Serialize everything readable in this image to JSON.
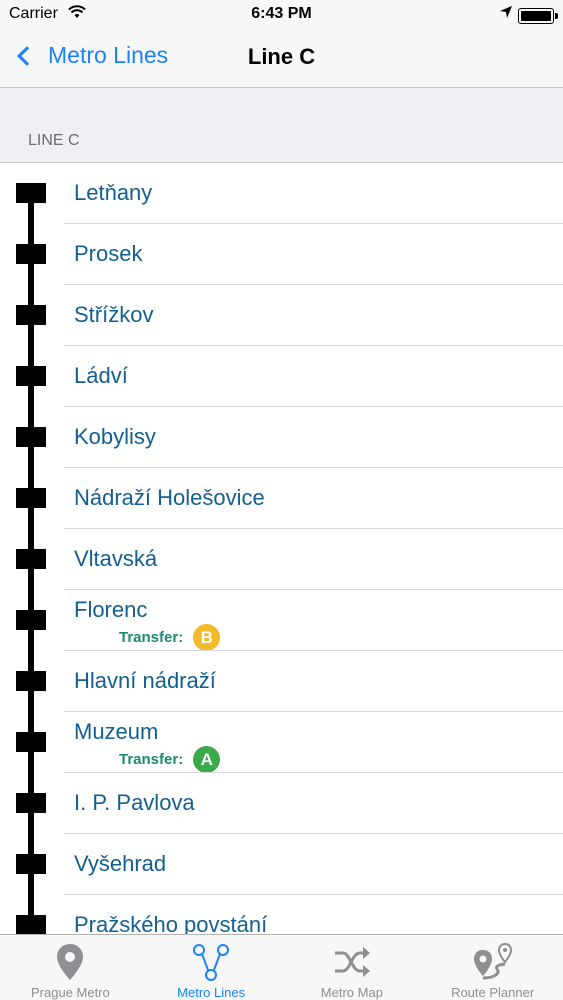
{
  "status_bar": {
    "carrier": "Carrier",
    "time": "6:43 PM"
  },
  "nav": {
    "back_label": "Metro Lines",
    "title": "Line C"
  },
  "section_header": "LINE C",
  "stations": [
    {
      "name": "Letňany"
    },
    {
      "name": "Prosek"
    },
    {
      "name": "Střížkov"
    },
    {
      "name": "Ládví"
    },
    {
      "name": "Kobylisy"
    },
    {
      "name": "Nádraží Holešovice"
    },
    {
      "name": "Vltavská"
    },
    {
      "name": "Florenc",
      "transfer_label": "Transfer:",
      "transfer_line": "B",
      "transfer_color": "#f2b928"
    },
    {
      "name": "Hlavní nádraží"
    },
    {
      "name": "Muzeum",
      "transfer_label": "Transfer:",
      "transfer_line": "A",
      "transfer_color": "#3aaa4a"
    },
    {
      "name": "I. P. Pavlova"
    },
    {
      "name": "Vyšehrad"
    },
    {
      "name": "Pražského povstání"
    }
  ],
  "tabs": [
    {
      "label": "Prague Metro",
      "icon": "map-pin-icon",
      "active": false
    },
    {
      "label": "Metro Lines",
      "icon": "metro-lines-icon",
      "active": true
    },
    {
      "label": "Metro Map",
      "icon": "shuffle-icon",
      "active": false
    },
    {
      "label": "Route Planner",
      "icon": "route-planner-icon",
      "active": false
    }
  ],
  "colors": {
    "accent": "#1a82fb",
    "station_text": "#135f92",
    "transfer_text": "#1e8a72",
    "line_track": "#000000"
  }
}
